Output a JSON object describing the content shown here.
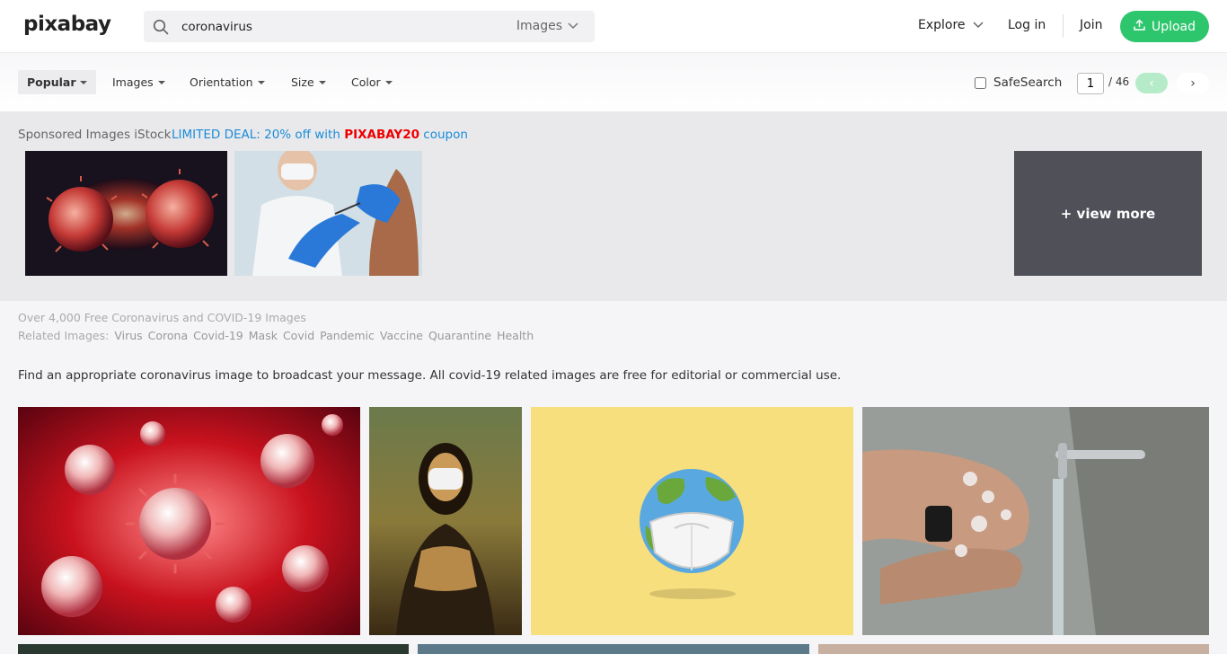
{
  "header": {
    "logo": "pixabay",
    "search_value": "coronavirus",
    "search_type": "Images",
    "explore": "Explore",
    "login": "Log in",
    "join": "Join",
    "upload": "Upload"
  },
  "filters": {
    "popular": "Popular",
    "images": "Images",
    "orientation": "Orientation",
    "size": "Size",
    "color": "Color",
    "safesearch": "SafeSearch",
    "page": "1",
    "total": "/ 46",
    "prev": "‹",
    "next": "›"
  },
  "sponsored": {
    "label": "Sponsored Images iStock",
    "deal_prefix": "LIMITED DEAL: 20% off with ",
    "deal_code": "PIXABAY20",
    "deal_suffix": " coupon",
    "view_more": "+ view more"
  },
  "info": {
    "title": "Over 4,000 Free Coronavirus and COVID-19 Images",
    "related_label": "Related Images:",
    "related_tags": [
      "Virus",
      "Corona",
      "Covid-19",
      "Mask",
      "Covid",
      "Pandemic",
      "Vaccine",
      "Quarantine",
      "Health"
    ],
    "description": "Find an appropriate coronavirus image to broadcast your message. All covid-19 related images are free for editorial or commercial use."
  },
  "colors": {
    "accent": "#2ec66d",
    "link": "#1a8cd8",
    "coupon": "#ee0000"
  }
}
